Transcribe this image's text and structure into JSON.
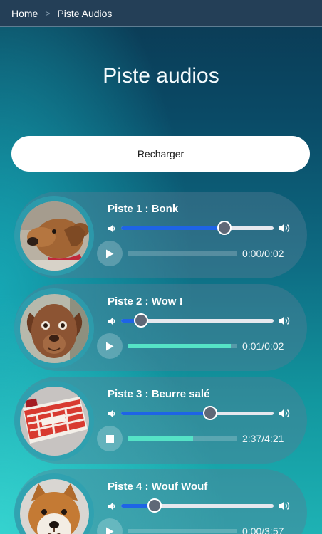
{
  "breadcrumb": {
    "home": "Home",
    "separator": ">",
    "current": "Piste Audios"
  },
  "page_title": "Piste audios",
  "reload_label": "Recharger",
  "colors": {
    "accent_blue": "#1e64e6",
    "progress_green": "#55e3c6",
    "topbar": "#243f57"
  },
  "tracks": [
    {
      "title": "Piste 1 : Bonk",
      "time": "0:00/0:02",
      "volume": 0.67,
      "progress": 0.0,
      "state": "paused",
      "button_icon": "play-icon",
      "cover": "dachshund-dog"
    },
    {
      "title": "Piste 2 : Wow !",
      "time": "0:01/0:02",
      "volume": 0.13,
      "progress": 0.94,
      "state": "paused",
      "button_icon": "play-icon",
      "cover": "brown-dog-face"
    },
    {
      "title": "Piste 3 : Beurre salé",
      "time": "2:37/4:21",
      "volume": 0.59,
      "progress": 0.6,
      "state": "playing",
      "button_icon": "stop-icon",
      "cover": "butter-package"
    },
    {
      "title": "Piste 4 : Wouf Wouf",
      "time": "0:00/3:57",
      "volume": 0.22,
      "progress": 0.0,
      "state": "paused",
      "button_icon": "play-icon",
      "cover": "shiba-dog"
    }
  ]
}
